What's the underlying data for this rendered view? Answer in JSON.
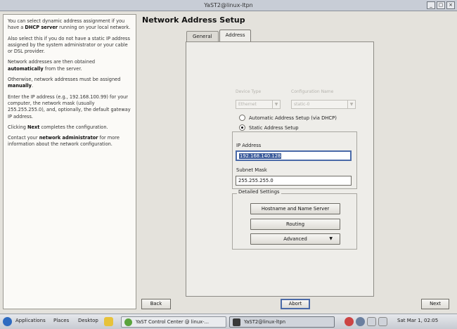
{
  "window": {
    "title": "YaST2@linux-ltpn",
    "buttons": [
      "_",
      "▢",
      "×"
    ]
  },
  "help_text": [
    {
      "parts": [
        {
          "t": "You can select dynamic address assignment if you have a "
        },
        {
          "t": "DHCP server",
          "b": true
        },
        {
          "t": " running on your local network."
        }
      ]
    },
    {
      "parts": [
        {
          "t": "Also select this if you do not have a static IP address assigned by the system administrator or your cable or DSL provider."
        }
      ]
    },
    {
      "parts": [
        {
          "t": "Network addresses are then obtained "
        },
        {
          "t": "automatically",
          "b": true
        },
        {
          "t": " from the server."
        }
      ]
    },
    {
      "parts": [
        {
          "t": "Otherwise, network addresses must be assigned "
        },
        {
          "t": "manually",
          "b": true
        },
        {
          "t": "."
        }
      ]
    },
    {
      "parts": [
        {
          "t": "Enter the IP address (e.g., 192.168.100.99) for your computer, the network mask (usually 255.255.255.0), and, optionally, the default gateway IP address."
        }
      ]
    },
    {
      "parts": [
        {
          "t": "Clicking "
        },
        {
          "t": "Next",
          "b": true
        },
        {
          "t": " completes the configuration."
        }
      ]
    },
    {
      "parts": [
        {
          "t": "Contact your "
        },
        {
          "t": "network administrator",
          "b": true
        },
        {
          "t": " for more information about the network configuration."
        }
      ]
    }
  ],
  "dialog": {
    "title": "Network Address Setup",
    "tabs": [
      {
        "label": "General",
        "active": false
      },
      {
        "label": "Address",
        "active": true
      }
    ],
    "device_type": {
      "label": "Device Type",
      "value": "Ethernet"
    },
    "config_name": {
      "label": "Configuration Name",
      "value": "static-0"
    },
    "radio_dhcp": {
      "label": "Automatic Address Setup (via DHCP)",
      "selected": false
    },
    "radio_static": {
      "label": "Static Address Setup",
      "selected": true
    },
    "ip_address": {
      "label": "IP Address",
      "value": "192.168.140.128"
    },
    "subnet_mask": {
      "label": "Subnet Mask",
      "value": "255.255.255.0"
    },
    "detailed_settings": {
      "label": "Detailed Settings",
      "hostname_button": "Hostname and Name Server",
      "routing_button": "Routing",
      "advanced_button": "Advanced"
    }
  },
  "bottom_buttons": {
    "back": "Back",
    "abort": "Abort",
    "next": "Next"
  },
  "taskbar": {
    "applications": "Applications",
    "places": "Places",
    "desktop": "Desktop",
    "tasks": [
      {
        "label": "YaST Control Center @ linux-...",
        "active": false
      },
      {
        "label": "YaST2@linux-ltpn",
        "active": true
      }
    ],
    "clock": "Sat Mar 1, 02:05"
  },
  "colors": {
    "selection": "#3b5b9b",
    "focus_border": "#4a6aa8"
  }
}
